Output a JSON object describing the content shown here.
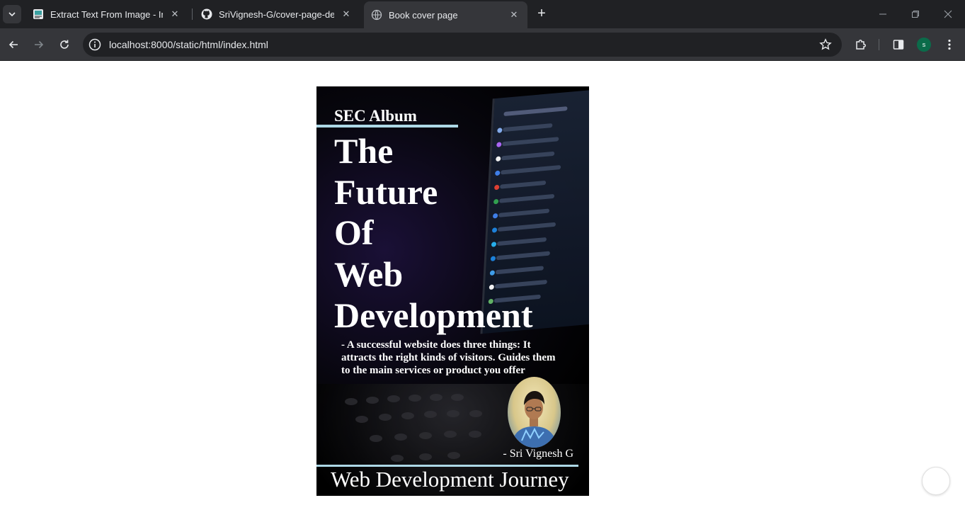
{
  "browser": {
    "tabs": [
      {
        "title": "Extract Text From Image - Image",
        "favicon": "image-to-text-icon",
        "active": false
      },
      {
        "title": "SriVignesh-G/cover-page-design",
        "favicon": "github-icon",
        "active": false
      },
      {
        "title": "Book cover page",
        "favicon": "globe-icon",
        "active": true
      }
    ],
    "url": "localhost:8000/static/html/index.html",
    "profile_initial": "s",
    "colors": {
      "tabbar": "#202124",
      "toolbar": "#35363a",
      "avatar": "#0b6b4a"
    }
  },
  "cover": {
    "album": "SEC Album",
    "title_lines": [
      "The",
      "Future",
      "Of",
      "Web",
      "Development"
    ],
    "quote_lines": [
      "- A successful website does three things: It",
      "attracts the right kinds of visitors. Guides them",
      "to the main services or product you offer"
    ],
    "author": "- Sri Vignesh G",
    "footer": "Web Development Journey",
    "accent": "#add8e6"
  }
}
